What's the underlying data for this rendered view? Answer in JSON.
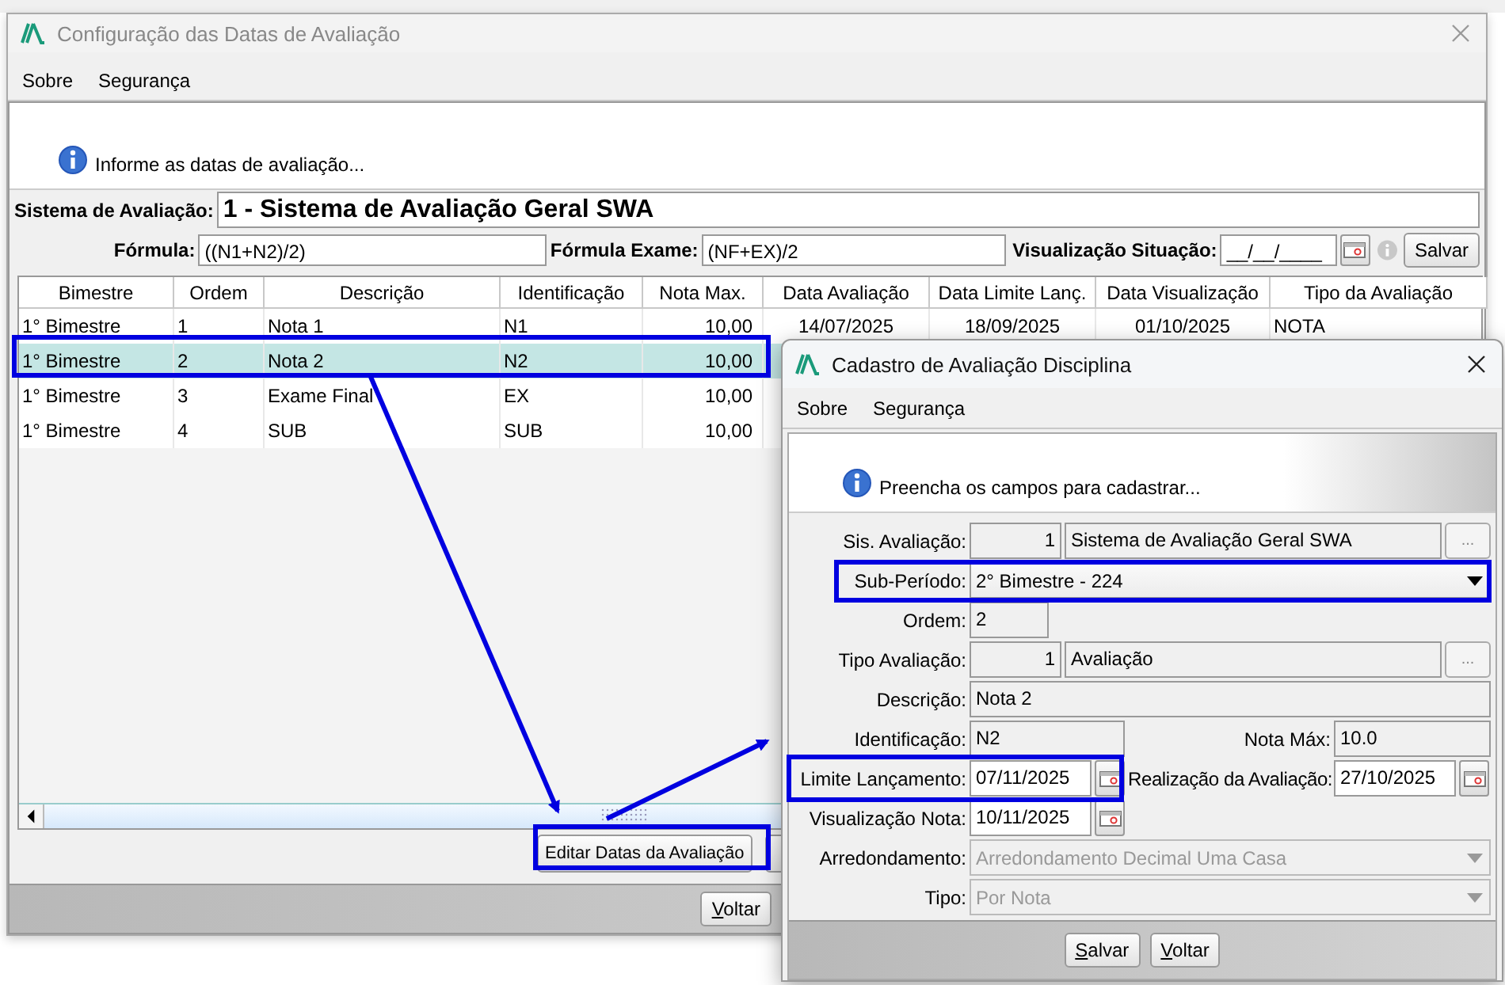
{
  "main_window": {
    "title": "Configuração das Datas de Avaliação",
    "menu": [
      "Sobre",
      "Segurança"
    ],
    "info": "Informe as datas de avaliação...",
    "sistema": {
      "label": "Sistema de Avaliação:",
      "value": "1 - Sistema de Avaliação Geral SWA"
    },
    "formula": {
      "label": "Fórmula:",
      "value": "((N1+N2)/2)"
    },
    "formula_exame": {
      "label": "Fórmula Exame:",
      "value": "(NF+EX)/2"
    },
    "visualizacao": {
      "label": "Visualização Situação:",
      "value": "__/__/____"
    },
    "save_button": "Salvar",
    "table": {
      "columns": [
        "Bimestre",
        "Ordem",
        "Descrição",
        "Identificação",
        "Nota Max.",
        "Data Avaliação",
        "Data Limite Lanç.",
        "Data Visualização",
        "Tipo da Avaliação"
      ],
      "rows": [
        {
          "selected": false,
          "cells": [
            "1° Bimestre",
            "1",
            "Nota 1",
            "N1",
            "10,00",
            "14/07/2025",
            "18/09/2025",
            "01/10/2025",
            "NOTA"
          ]
        },
        {
          "selected": true,
          "cells": [
            "1° Bimestre",
            "2",
            "Nota 2",
            "N2",
            "10,00"
          ]
        },
        {
          "selected": false,
          "cells": [
            "1° Bimestre",
            "3",
            "Exame Final",
            "EX",
            "10,00"
          ]
        },
        {
          "selected": false,
          "cells": [
            "1° Bimestre",
            "4",
            "SUB",
            "SUB",
            "10,00"
          ]
        }
      ]
    },
    "buttons": [
      "Editar Datas da Avaliação"
    ],
    "footer_button": "Voltar"
  },
  "dialog": {
    "title": "Cadastro de Avaliação Disciplina",
    "menu": [
      "Sobre",
      "Segurança"
    ],
    "info": "Preencha os campos para cadastrar...",
    "fields": [
      {
        "kind": "lookup",
        "label": "Sis. Avaliação:",
        "code": "1",
        "value": "Sistema de Avaliação Geral SWA",
        "button": "..."
      },
      {
        "kind": "select",
        "label": "Sub-Período:",
        "value": "2° Bimestre - 224",
        "disabled": false
      },
      {
        "kind": "short",
        "label": "Ordem:",
        "value": "2",
        "readonly": true
      },
      {
        "kind": "lookup",
        "label": "Tipo Avaliação:",
        "code": "1",
        "value": "Avaliação",
        "button": "..."
      },
      {
        "kind": "text",
        "label": "Descrição:",
        "value": "Nota 2",
        "readonly": true
      },
      {
        "kind": "pair",
        "label": "Identificação:",
        "value": "N2",
        "readonly": true,
        "label2": "Nota Máx:",
        "value2": "10.0"
      },
      {
        "kind": "date_pair",
        "label": "Limite Lançamento:",
        "value": "07/11/2025",
        "label2": "Realização da Avaliação:",
        "value2": "27/10/2025"
      },
      {
        "kind": "date",
        "label": "Visualização Nota:",
        "value": "10/11/2025"
      },
      {
        "kind": "select",
        "label": "Arredondamento:",
        "value": "Arredondamento Decimal Uma Casa",
        "disabled": true
      },
      {
        "kind": "select",
        "label": "Tipo:",
        "value": "Por Nota",
        "disabled": true
      }
    ],
    "buttons": [
      "Salvar",
      "Voltar"
    ]
  }
}
